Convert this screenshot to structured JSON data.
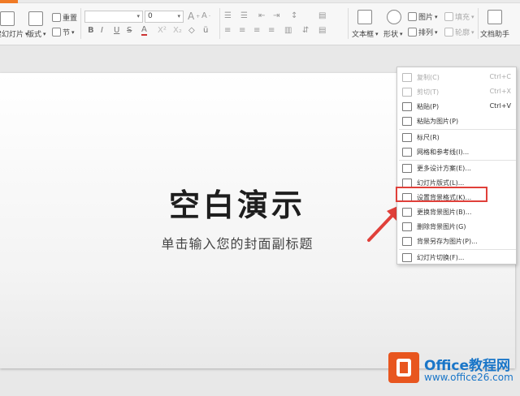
{
  "ribbon": {
    "new_slide_label": "新建幻灯片",
    "layout_label": "版式",
    "reset_label": "重置",
    "section_label": "节",
    "font_size_value": "0",
    "grow_font": "A",
    "shrink_font": "A",
    "bold": "B",
    "italic": "I",
    "underline": "U",
    "strike": "S",
    "font_color": "A",
    "superscript": "X²",
    "subscript": "X₂",
    "textbox_label": "文本框",
    "shape_label": "形状",
    "picture_label": "图片",
    "fill_label": "填充",
    "arrange_label": "排列",
    "outline_label": "轮廓",
    "doc_helper_label": "文档助手"
  },
  "slide": {
    "title": "空白演示",
    "subtitle": "单击输入您的封面副标题"
  },
  "context_menu": {
    "items": [
      {
        "label": "复制(C)",
        "shortcut": "Ctrl+C",
        "icon": "copy-icon",
        "disabled": true
      },
      {
        "label": "剪切(T)",
        "shortcut": "Ctrl+X",
        "icon": "cut-icon",
        "disabled": true
      },
      {
        "label": "粘贴(P)",
        "shortcut": "Ctrl+V",
        "icon": "paste-icon",
        "disabled": false
      },
      {
        "label": "粘贴为图片(P)",
        "shortcut": "",
        "icon": "paste-picture-icon",
        "disabled": false
      },
      {
        "label": "标尺(R)",
        "shortcut": "",
        "icon": "ruler-icon",
        "disabled": false
      },
      {
        "label": "网格和参考线(I)...",
        "shortcut": "",
        "icon": "grid-icon",
        "disabled": false
      },
      {
        "label": "更多设计方案(E)...",
        "shortcut": "",
        "icon": "design-icon",
        "disabled": false
      },
      {
        "label": "幻灯片版式(L)...",
        "shortcut": "",
        "icon": "layout-icon",
        "disabled": false
      },
      {
        "label": "设置背景格式(K)...",
        "shortcut": "",
        "icon": "background-format-icon",
        "disabled": false
      },
      {
        "label": "更换背景图片(B)...",
        "shortcut": "",
        "icon": "change-background-icon",
        "disabled": false
      },
      {
        "label": "删除背景图片(G)",
        "shortcut": "",
        "icon": "delete-background-icon",
        "disabled": false
      },
      {
        "label": "背景另存为图片(P)...",
        "shortcut": "",
        "icon": "save-background-icon",
        "disabled": false
      },
      {
        "label": "幻灯片切换(F)...",
        "shortcut": "",
        "icon": "transition-icon",
        "disabled": false
      }
    ]
  },
  "watermark": {
    "line1": "Office教程网",
    "line2": "www.office26.com"
  },
  "colors": {
    "highlight": "#e0403a",
    "brand_orange": "#e8561f",
    "brand_blue": "#1a76c8"
  }
}
